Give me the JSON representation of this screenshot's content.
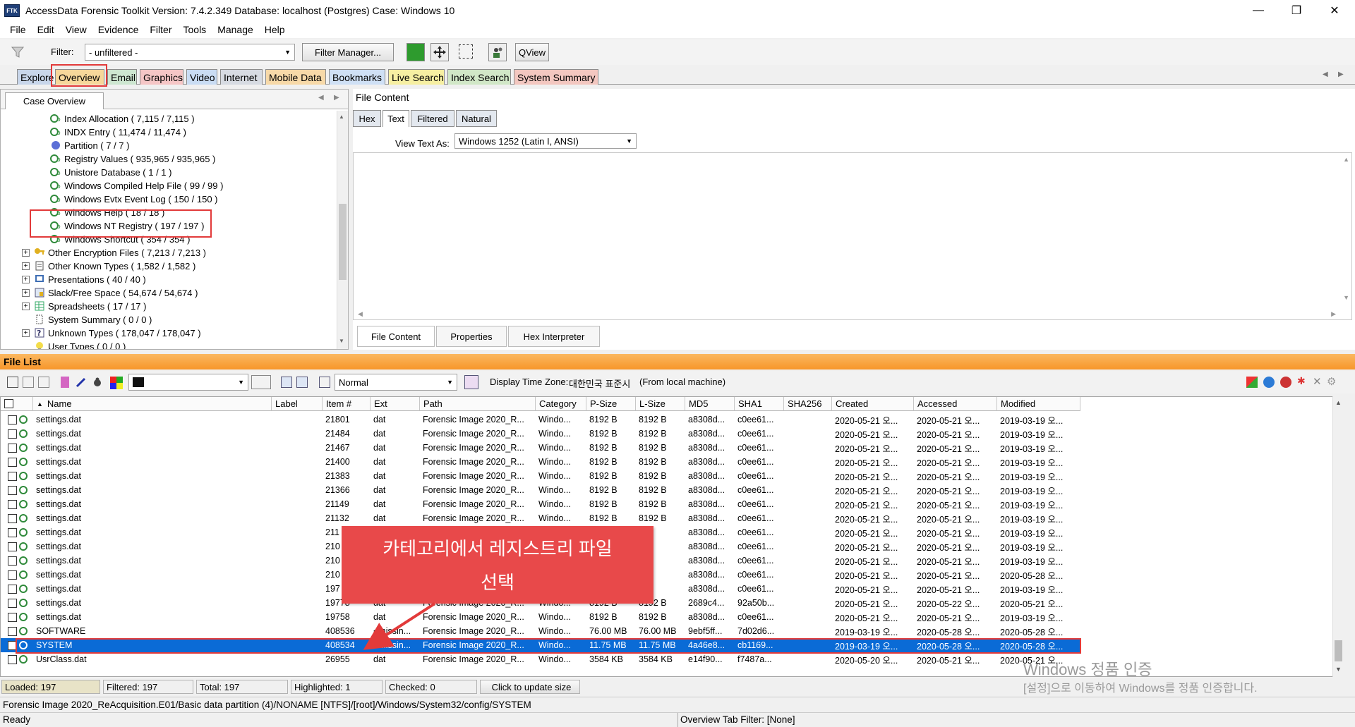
{
  "window": {
    "title": "AccessData Forensic Toolkit Version: 7.4.2.349 Database: localhost (Postgres) Case: Windows 10",
    "icon_label": "FTK",
    "minimize": "—",
    "restore": "❐",
    "close": "✕"
  },
  "menu": [
    "File",
    "Edit",
    "View",
    "Evidence",
    "Filter",
    "Tools",
    "Manage",
    "Help"
  ],
  "toolbar": {
    "filter_label": "Filter:",
    "filter_value": "- unfiltered -",
    "filter_manager": "Filter Manager...",
    "qview": "QView"
  },
  "tabs": [
    "Explore",
    "Overview",
    "Email",
    "Graphics",
    "Video",
    "Internet",
    "Mobile Data",
    "Bookmarks",
    "Live Search",
    "Index Search",
    "System Summary"
  ],
  "left_panel": {
    "tab": "Case Overview",
    "tree": [
      {
        "label": "Index Allocation ( 7,115 / 7,115 )",
        "icon": "file-category-icon"
      },
      {
        "label": "INDX Entry ( 11,474 / 11,474 )",
        "icon": "file-category-icon"
      },
      {
        "label": "Partition ( 7 / 7 )",
        "icon": "partition-icon"
      },
      {
        "label": "Registry Values ( 935,965 / 935,965 )",
        "icon": "file-category-icon"
      },
      {
        "label": "Unistore Database ( 1 / 1 )",
        "icon": "file-category-icon"
      },
      {
        "label": "Windows Compiled Help File ( 99 / 99 )",
        "icon": "file-category-icon"
      },
      {
        "label": "Windows Evtx Event Log ( 150 / 150 )",
        "icon": "file-category-icon"
      },
      {
        "label": "Windows Help ( 18 / 18 )",
        "icon": "file-category-icon"
      },
      {
        "label": "Windows NT Registry ( 197 / 197 )",
        "icon": "file-category-icon"
      },
      {
        "label": "Windows Shortcut ( 354 / 354 )",
        "icon": "file-category-icon"
      },
      {
        "label": "Other Encryption Files ( 7,213 / 7,213 )",
        "icon": "key-icon"
      },
      {
        "label": "Other Known Types ( 1,582 / 1,582 )",
        "icon": "document-icon"
      },
      {
        "label": "Presentations ( 40 / 40 )",
        "icon": "presentation-icon"
      },
      {
        "label": "Slack/Free Space ( 54,674 / 54,674 )",
        "icon": "slack-space-icon"
      },
      {
        "label": "Spreadsheets ( 17 / 17 )",
        "icon": "spreadsheet-icon"
      },
      {
        "label": "System Summary ( 0 / 0 )",
        "icon": "system-icon"
      },
      {
        "label": "Unknown Types ( 178,047 / 178,047 )",
        "icon": "question-icon"
      },
      {
        "label": "User Types ( 0 / 0 )",
        "icon": "bulb-icon"
      }
    ]
  },
  "right_panel": {
    "title": "File Content",
    "view_tabs": [
      "Hex",
      "Text",
      "Filtered",
      "Natural"
    ],
    "view_text_as_label": "View Text As:",
    "view_text_as_value": "Windows 1252 (Latin I, ANSI)",
    "bottom_tabs": [
      "File Content",
      "Properties",
      "Hex Interpreter"
    ]
  },
  "file_list": {
    "title": "File List",
    "mode": "Normal",
    "time_zone_label": "Display Time Zone:",
    "time_zone_value": "대한민국 표준시",
    "time_zone_source": "(From local machine)",
    "columns": [
      "Name",
      "Label",
      "Item #",
      "Ext",
      "Path",
      "Category",
      "P-Size",
      "L-Size",
      "MD5",
      "SHA1",
      "SHA256",
      "Created",
      "Accessed",
      "Modified"
    ],
    "rows": [
      {
        "name": "settings.dat",
        "item": "21801",
        "ext": "dat",
        "path": "Forensic Image 2020_R...",
        "category": "Windo...",
        "psize": "8192 B",
        "lsize": "8192 B",
        "md5": "a8308d...",
        "sha1": "c0ee61...",
        "created": "2020-05-21 오...",
        "accessed": "2020-05-21 오...",
        "modified": "2019-03-19 오..."
      },
      {
        "name": "settings.dat",
        "item": "21484",
        "ext": "dat",
        "path": "Forensic Image 2020_R...",
        "category": "Windo...",
        "psize": "8192 B",
        "lsize": "8192 B",
        "md5": "a8308d...",
        "sha1": "c0ee61...",
        "created": "2020-05-21 오...",
        "accessed": "2020-05-21 오...",
        "modified": "2019-03-19 오..."
      },
      {
        "name": "settings.dat",
        "item": "21467",
        "ext": "dat",
        "path": "Forensic Image 2020_R...",
        "category": "Windo...",
        "psize": "8192 B",
        "lsize": "8192 B",
        "md5": "a8308d...",
        "sha1": "c0ee61...",
        "created": "2020-05-21 오...",
        "accessed": "2020-05-21 오...",
        "modified": "2019-03-19 오..."
      },
      {
        "name": "settings.dat",
        "item": "21400",
        "ext": "dat",
        "path": "Forensic Image 2020_R...",
        "category": "Windo...",
        "psize": "8192 B",
        "lsize": "8192 B",
        "md5": "a8308d...",
        "sha1": "c0ee61...",
        "created": "2020-05-21 오...",
        "accessed": "2020-05-21 오...",
        "modified": "2019-03-19 오..."
      },
      {
        "name": "settings.dat",
        "item": "21383",
        "ext": "dat",
        "path": "Forensic Image 2020_R...",
        "category": "Windo...",
        "psize": "8192 B",
        "lsize": "8192 B",
        "md5": "a8308d...",
        "sha1": "c0ee61...",
        "created": "2020-05-21 오...",
        "accessed": "2020-05-21 오...",
        "modified": "2019-03-19 오..."
      },
      {
        "name": "settings.dat",
        "item": "21366",
        "ext": "dat",
        "path": "Forensic Image 2020_R...",
        "category": "Windo...",
        "psize": "8192 B",
        "lsize": "8192 B",
        "md5": "a8308d...",
        "sha1": "c0ee61...",
        "created": "2020-05-21 오...",
        "accessed": "2020-05-21 오...",
        "modified": "2019-03-19 오..."
      },
      {
        "name": "settings.dat",
        "item": "21149",
        "ext": "dat",
        "path": "Forensic Image 2020_R...",
        "category": "Windo...",
        "psize": "8192 B",
        "lsize": "8192 B",
        "md5": "a8308d...",
        "sha1": "c0ee61...",
        "created": "2020-05-21 오...",
        "accessed": "2020-05-21 오...",
        "modified": "2019-03-19 오..."
      },
      {
        "name": "settings.dat",
        "item": "21132",
        "ext": "dat",
        "path": "Forensic Image 2020_R...",
        "category": "Windo...",
        "psize": "8192 B",
        "lsize": "8192 B",
        "md5": "a8308d...",
        "sha1": "c0ee61...",
        "created": "2020-05-21 오...",
        "accessed": "2020-05-21 오...",
        "modified": "2019-03-19 오..."
      },
      {
        "name": "settings.dat",
        "item": "211",
        "ext": "",
        "path": "",
        "category": "",
        "psize": "",
        "lsize": "2 B",
        "md5": "a8308d...",
        "sha1": "c0ee61...",
        "created": "2020-05-21 오...",
        "accessed": "2020-05-21 오...",
        "modified": "2019-03-19 오..."
      },
      {
        "name": "settings.dat",
        "item": "210",
        "ext": "",
        "path": "",
        "category": "",
        "psize": "",
        "lsize": "2 B",
        "md5": "a8308d...",
        "sha1": "c0ee61...",
        "created": "2020-05-21 오...",
        "accessed": "2020-05-21 오...",
        "modified": "2019-03-19 오..."
      },
      {
        "name": "settings.dat",
        "item": "210",
        "ext": "",
        "path": "",
        "category": "",
        "psize": "",
        "lsize": "2 B",
        "md5": "a8308d...",
        "sha1": "c0ee61...",
        "created": "2020-05-21 오...",
        "accessed": "2020-05-21 오...",
        "modified": "2019-03-19 오..."
      },
      {
        "name": "settings.dat",
        "item": "210",
        "ext": "",
        "path": "",
        "category": "",
        "psize": "",
        "lsize": "2 B",
        "md5": "a8308d...",
        "sha1": "c0ee61...",
        "created": "2020-05-21 오...",
        "accessed": "2020-05-21 오...",
        "modified": "2020-05-28 오..."
      },
      {
        "name": "settings.dat",
        "item": "197",
        "ext": "",
        "path": "",
        "category": "",
        "psize": "",
        "lsize": "2 B",
        "md5": "a8308d...",
        "sha1": "c0ee61...",
        "created": "2020-05-21 오...",
        "accessed": "2020-05-21 오...",
        "modified": "2019-03-19 오..."
      },
      {
        "name": "settings.dat",
        "item": "19778",
        "ext": "dat",
        "path": "Forensic Image 2020_R...",
        "category": "Windo...",
        "psize": "8192 B",
        "lsize": "8192 B",
        "md5": "2689c4...",
        "sha1": "92a50b...",
        "created": "2020-05-21 오...",
        "accessed": "2020-05-22 오...",
        "modified": "2020-05-21 오..."
      },
      {
        "name": "settings.dat",
        "item": "19758",
        "ext": "dat",
        "path": "Forensic Image 2020_R...",
        "category": "Windo...",
        "psize": "8192 B",
        "lsize": "8192 B",
        "md5": "a8308d...",
        "sha1": "c0ee61...",
        "created": "2020-05-21 오...",
        "accessed": "2020-05-21 오...",
        "modified": "2019-03-19 오..."
      },
      {
        "name": "SOFTWARE",
        "item": "408536",
        "ext": "<missin...",
        "path": "Forensic Image 2020_R...",
        "category": "Windo...",
        "psize": "76.00 MB",
        "lsize": "76.00 MB",
        "md5": "9ebf5ff...",
        "sha1": "7d02d6...",
        "created": "2019-03-19 오...",
        "accessed": "2020-05-28 오...",
        "modified": "2020-05-28 오..."
      },
      {
        "name": "SYSTEM",
        "item": "408534",
        "ext": "<missin...",
        "path": "Forensic Image 2020_R...",
        "category": "Windo...",
        "psize": "11.75 MB",
        "lsize": "11.75 MB",
        "md5": "4a46e8...",
        "sha1": "cb1169...",
        "created": "2019-03-19 오...",
        "accessed": "2020-05-28 오...",
        "modified": "2020-05-28 오..."
      },
      {
        "name": "UsrClass.dat",
        "item": "26955",
        "ext": "dat",
        "path": "Forensic Image 2020_R...",
        "category": "Windo...",
        "psize": "3584 KB",
        "lsize": "3584 KB",
        "md5": "e14f90...",
        "sha1": "f7487a...",
        "created": "2020-05-20 오...",
        "accessed": "2020-05-21 오...",
        "modified": "2020-05-21 오..."
      }
    ]
  },
  "status": {
    "loaded": "Loaded: 197",
    "filtered": "Filtered: 197",
    "total": "Total: 197",
    "highlighted": "Highlighted: 1",
    "checked": "Checked: 0",
    "update_size": "Click to update size",
    "path": "Forensic Image 2020_ReAcquisition.E01/Basic data partition (4)/NONAME [NTFS]/[root]/Windows/System32/config/SYSTEM",
    "ready": "Ready",
    "tab_filter": "Overview Tab Filter: [None]"
  },
  "annotation": {
    "callout_line1": "카테고리에서 레지스트리 파일",
    "callout_line2": "선택"
  },
  "watermark": {
    "line1": "Windows 정품 인증",
    "line2": "[설정]으로 이동하여 Windows를 정품 인증합니다."
  },
  "colors": {
    "accent_orange": "#f7962a",
    "selection_blue": "#0a6bd6",
    "annotation_red": "#e8494a"
  }
}
